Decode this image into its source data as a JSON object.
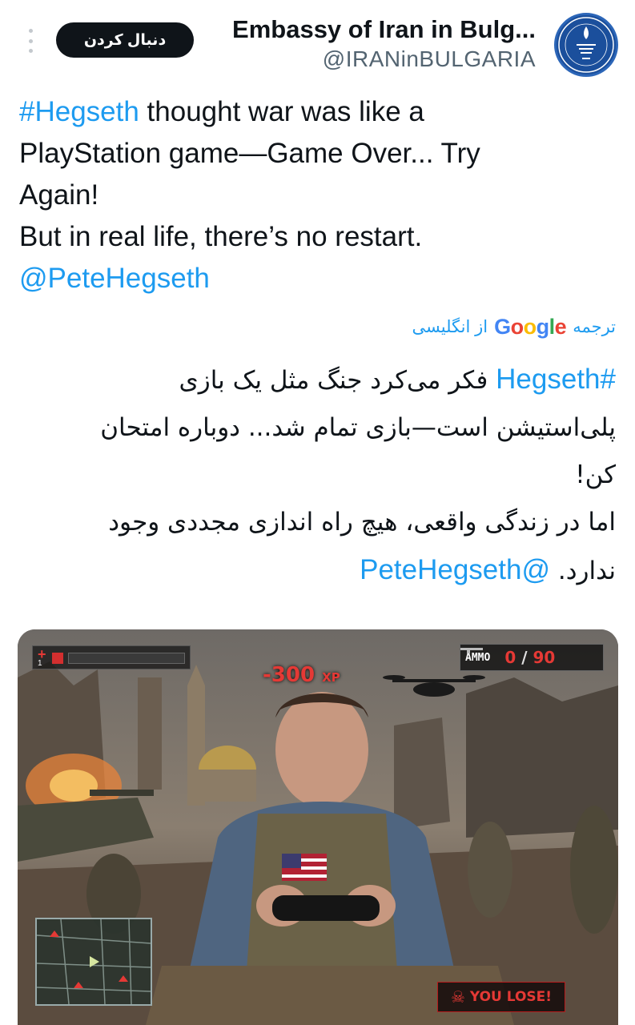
{
  "header": {
    "more_icon": "vertical-dots-icon",
    "follow_label": "دنبال کردن",
    "display_name": "Embassy of Iran in Bulg...",
    "handle": "@IRANinBULGARIA"
  },
  "tweet": {
    "hashtag": "#Hegseth",
    "line1_rest": " thought war was like a",
    "line2": "PlayStation game—Game Over... Try",
    "line3": "Again!",
    "line4": "But in real life, there’s no restart.",
    "mention": "@PeteHegseth"
  },
  "translation": {
    "prefix": "ترجمه",
    "google": [
      "G",
      "o",
      "o",
      "g",
      "l",
      "e"
    ],
    "suffix": "از انگلیسی",
    "line1_text": " فکر می‌کرد جنگ مثل یک بازی",
    "line1_hashtag": "#Hegseth",
    "line2": "پلی‌استیشن است—بازی تمام شد... دوباره امتحان",
    "line3": "کن!",
    "line4": "اما در زندگی واقعی، هیچ راه اندازی مجددی وجود",
    "line5_text": "ندارد. ",
    "line5_mention": "@PeteHegseth"
  },
  "media": {
    "health_cross": "+",
    "health_level": "1",
    "xp": "-300",
    "xp_unit": "XP",
    "ammo_label": "AMMO",
    "ammo_current": "0",
    "ammo_sep": " / ",
    "ammo_total": "90",
    "lose_icon": "skull-icon",
    "lose_text": "YOU LOSE!"
  },
  "colors": {
    "link": "#1d9bf0",
    "follow_bg": "#0f1419",
    "hud_red": "#e53935"
  }
}
